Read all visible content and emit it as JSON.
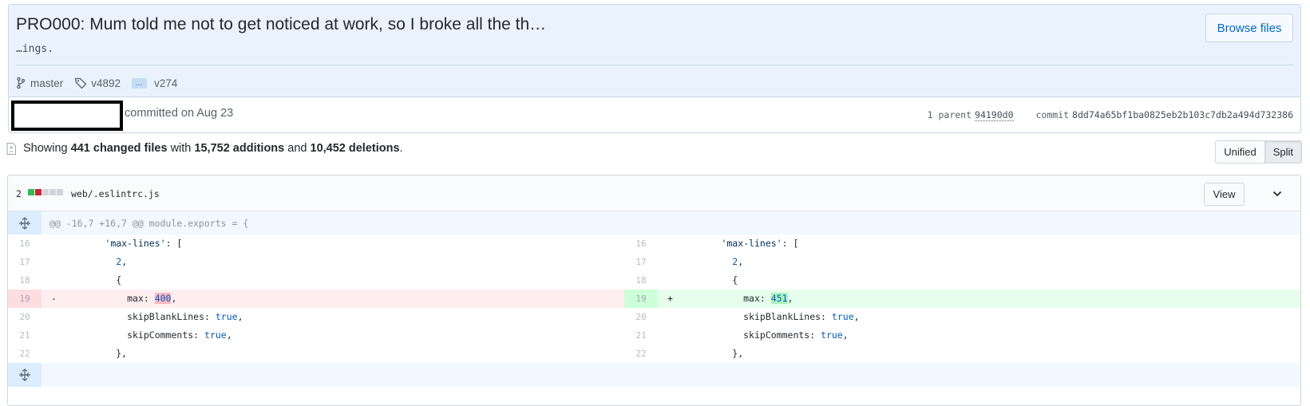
{
  "commit": {
    "title": "PRO000: Mum told me not to get noticed at work, so I broke all the th…",
    "description": "…ings.",
    "browse_label": "Browse files",
    "branch": "master",
    "tag_first": "v4892",
    "tag_ellipsis": "…",
    "tag_last": "v274",
    "committed_text": "committed on Aug 23",
    "parent_label": "1 parent",
    "parent_sha": "94190d0",
    "commit_label": "commit",
    "commit_sha": "8dd74a65bf1ba0825eb2b103c7db2a494d732386"
  },
  "summary": {
    "prefix": "Showing",
    "files": "441 changed files",
    "with": "with",
    "additions": "15,752 additions",
    "and": "and",
    "deletions": "10,452 deletions",
    "suffix": "."
  },
  "view_toggle": {
    "unified": "Unified",
    "split": "Split",
    "active": "Split"
  },
  "file": {
    "change_count": "2",
    "diffstat_colors": [
      "#2cbe4e",
      "#cb2431",
      "#d1d5da",
      "#d1d5da",
      "#d1d5da"
    ],
    "name": "web/.eslintrc.js",
    "view_label": "View",
    "hunk_header": "@@ -16,7 +16,7 @@ module.exports = {"
  },
  "diff": {
    "left": [
      {
        "ln": "16",
        "sign": "",
        "type": "ctx",
        "code": "        'max-lines': ["
      },
      {
        "ln": "17",
        "sign": "",
        "type": "ctx",
        "code": "          2,"
      },
      {
        "ln": "18",
        "sign": "",
        "type": "ctx",
        "code": "          {"
      },
      {
        "ln": "19",
        "sign": "-",
        "type": "del",
        "code": "            max: 400,"
      },
      {
        "ln": "20",
        "sign": "",
        "type": "ctx",
        "code": "            skipBlankLines: true,"
      },
      {
        "ln": "21",
        "sign": "",
        "type": "ctx",
        "code": "            skipComments: true,"
      },
      {
        "ln": "22",
        "sign": "",
        "type": "ctx",
        "code": "          },"
      }
    ],
    "right": [
      {
        "ln": "16",
        "sign": "",
        "type": "ctx",
        "code": "        'max-lines': ["
      },
      {
        "ln": "17",
        "sign": "",
        "type": "ctx",
        "code": "          2,"
      },
      {
        "ln": "18",
        "sign": "",
        "type": "ctx",
        "code": "          {"
      },
      {
        "ln": "19",
        "sign": "+",
        "type": "add",
        "code": "            max: 451,"
      },
      {
        "ln": "20",
        "sign": "",
        "type": "ctx",
        "code": "            skipBlankLines: true,"
      },
      {
        "ln": "21",
        "sign": "",
        "type": "ctx",
        "code": "            skipComments: true,"
      },
      {
        "ln": "22",
        "sign": "",
        "type": "ctx",
        "code": "          },"
      }
    ]
  },
  "icons": {
    "branch": "git-branch-icon",
    "tag": "tag-icon",
    "file": "file-diff-icon",
    "expand": "unfold-icon",
    "chevron": "chevron-down-icon"
  }
}
